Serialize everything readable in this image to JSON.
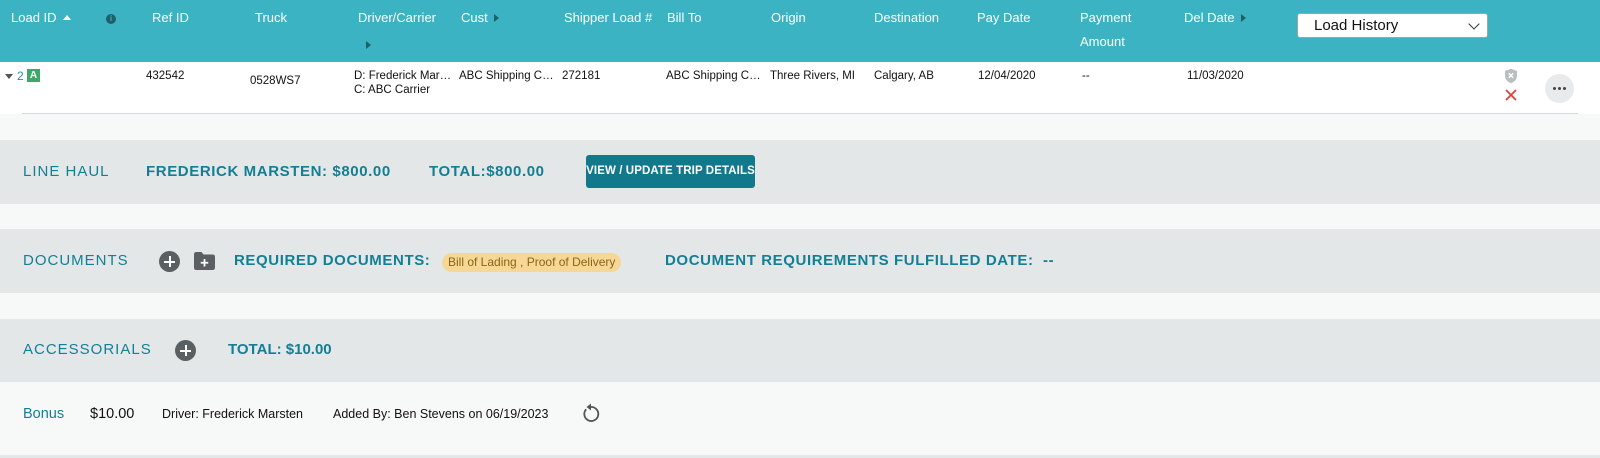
{
  "header": {
    "load_id": "Load ID",
    "ref_id": "Ref ID",
    "truck": "Truck",
    "driver_carrier": "Driver/Carrier",
    "cust": "Cust",
    "shipper_load": "Shipper Load #",
    "bill_to": "Bill To",
    "origin": "Origin",
    "destination": "Destination",
    "pay_date": "Pay Date",
    "payment_line1": "Payment",
    "payment_line2": "Amount",
    "del_date": "Del Date"
  },
  "row": {
    "load_number": "2",
    "status_badge": "A",
    "ref_id": "432542",
    "truck": "0528WS7",
    "driver": "D: Frederick Marsten",
    "carrier": "C: ABC Carrier",
    "customer": "ABC Shipping Company",
    "shipper_load": "272181",
    "bill_to": "ABC Shipping Company",
    "origin": "Three Rivers, MI",
    "destination": "Calgary, AB",
    "pay_date": "12/04/2020",
    "payment_amount": "--",
    "del_date": "11/03/2020",
    "action_select": "Load History"
  },
  "line_haul": {
    "label": "LINE HAUL",
    "driver_pay": "FREDERICK MARSTEN: $800.00",
    "total": "TOTAL:$800.00",
    "button": "VIEW / UPDATE TRIP DETAILS"
  },
  "documents": {
    "label": "DOCUMENTS",
    "required_label": "REQUIRED DOCUMENTS:",
    "required_value": "Bill of Lading , Proof of Delivery",
    "fulfilled_label": "DOCUMENT REQUIREMENTS FULFILLED DATE:",
    "fulfilled_value": "--"
  },
  "accessorials": {
    "label": "ACCESSORIALS",
    "total": "TOTAL: $10.00",
    "item": {
      "name": "Bonus",
      "amount": "$10.00",
      "driver": "Driver: Frederick Marsten",
      "added_by": "Added By: Ben Stevens on 06/19/2023"
    }
  },
  "colors": {
    "header_bg": "#3bb3c3",
    "accent": "#137f95",
    "button_bg": "#12798c",
    "badge_green": "#3ea86a",
    "pill_bg": "#f6d796"
  }
}
